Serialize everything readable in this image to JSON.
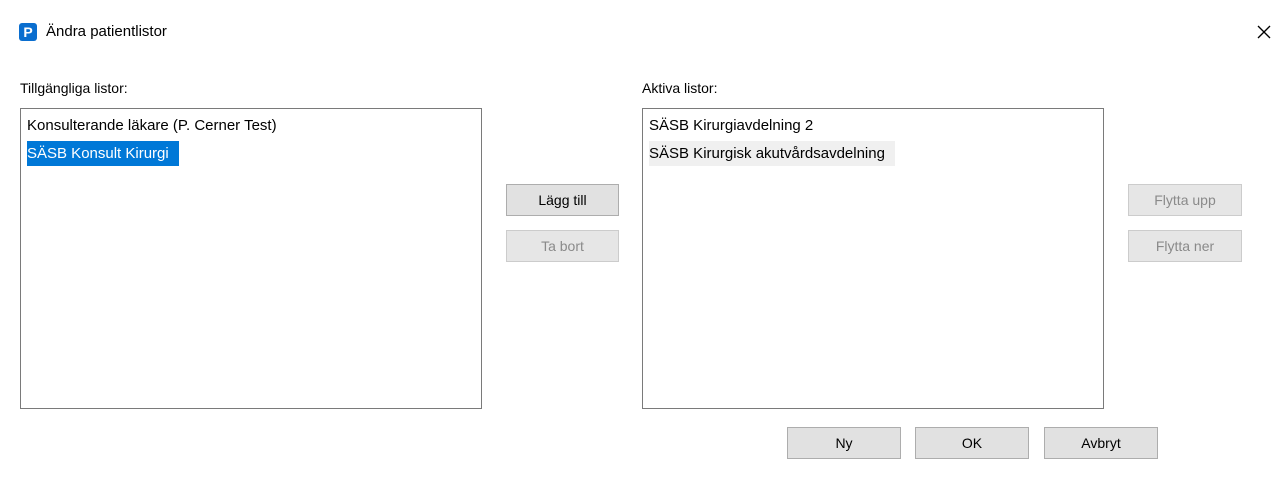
{
  "window": {
    "title": "Ändra patientlistor",
    "icon_letter": "P",
    "icon_color": "#0a6ecf"
  },
  "available": {
    "label": "Tillgängliga listor:",
    "items": [
      {
        "text": "Konsulterande läkare   (P. Cerner Test)",
        "selected": false
      },
      {
        "text": "SÄSB Konsult Kirurgi",
        "selected": true
      }
    ]
  },
  "active": {
    "label": "Aktiva listor:",
    "items": [
      {
        "text": "SÄSB Kirurgiavdelning 2",
        "highlight": false
      },
      {
        "text": "SÄSB Kirurgisk akutvårdsavdelning",
        "highlight": true
      }
    ]
  },
  "buttons": {
    "add": {
      "label": "Lägg till",
      "enabled": true
    },
    "remove": {
      "label": "Ta bort",
      "enabled": false
    },
    "move_up": {
      "label": "Flytta upp",
      "enabled": false
    },
    "move_down": {
      "label": "Flytta ner",
      "enabled": false
    },
    "new": {
      "label": "Ny",
      "enabled": true
    },
    "ok": {
      "label": "OK",
      "enabled": true
    },
    "cancel": {
      "label": "Avbryt",
      "enabled": true
    }
  },
  "colors": {
    "selection": "#0078d7",
    "hover_highlight": "#f0f0f0"
  },
  "icons": {
    "close": "close-icon",
    "app": "app-logo-icon"
  }
}
